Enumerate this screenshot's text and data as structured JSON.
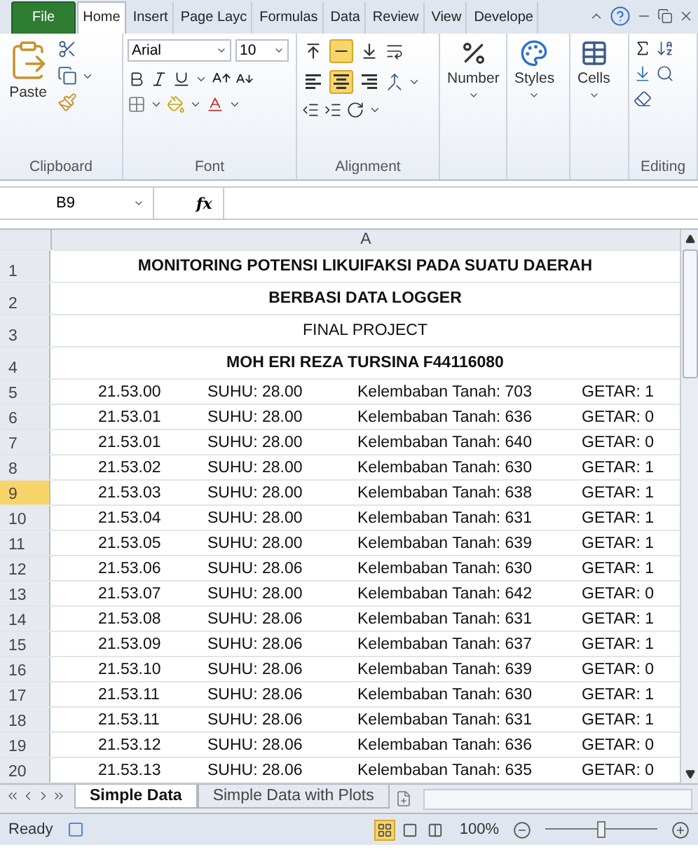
{
  "menu_tabs": [
    {
      "label": "File",
      "kind": "file",
      "selected": false
    },
    {
      "label": "Home",
      "kind": "tab",
      "selected": true
    },
    {
      "label": "Insert",
      "kind": "tab",
      "selected": false
    },
    {
      "label": "Page Layc",
      "kind": "tab",
      "selected": false
    },
    {
      "label": "Formulas",
      "kind": "tab",
      "selected": false
    },
    {
      "label": "Data",
      "kind": "tab",
      "selected": false
    },
    {
      "label": "Review",
      "kind": "tab",
      "selected": false
    },
    {
      "label": "View",
      "kind": "tab",
      "selected": false
    },
    {
      "label": "Develope",
      "kind": "tab",
      "selected": false
    }
  ],
  "ribbon": {
    "clipboard": {
      "label": "Clipboard",
      "paste": "Paste"
    },
    "font": {
      "label": "Font",
      "name": "Arial",
      "size": "10"
    },
    "alignment": {
      "label": "Alignment",
      "vertical": [
        {
          "kind": "top",
          "selected": false
        },
        {
          "kind": "middle",
          "selected": true
        },
        {
          "kind": "bottom",
          "selected": false
        }
      ],
      "horizontal": [
        {
          "kind": "left",
          "selected": false
        },
        {
          "kind": "center",
          "selected": true
        },
        {
          "kind": "right",
          "selected": false
        }
      ]
    },
    "number": {
      "label": "Number"
    },
    "styles": {
      "label": "Styles"
    },
    "cells": {
      "label": "Cells"
    },
    "editing": {
      "label": "Editing"
    }
  },
  "formula_bar": {
    "name_box": "B9",
    "function_symbol": "fx"
  },
  "sheet": {
    "column": "A",
    "rows": [
      {
        "number": "1",
        "kind": "title",
        "bold": true,
        "selected": false,
        "text": "MONITORING POTENSI LIKUIFAKSI PADA SUATU DAERAH"
      },
      {
        "number": "2",
        "kind": "title",
        "bold": true,
        "selected": false,
        "text": "BERBASI DATA LOGGER"
      },
      {
        "number": "3",
        "kind": "title",
        "bold": false,
        "selected": false,
        "text": "FINAL PROJECT"
      },
      {
        "number": "4",
        "kind": "title",
        "bold": true,
        "selected": false,
        "text": "MOH ERI REZA TURSINA F44116080"
      },
      {
        "number": "5",
        "kind": "data",
        "selected": false,
        "cells": [
          "21.53.00",
          "SUHU: 28.00",
          "Kelembaban Tanah: 703",
          "GETAR: 1"
        ]
      },
      {
        "number": "6",
        "kind": "data",
        "selected": false,
        "cells": [
          "21.53.01",
          "SUHU: 28.00",
          "Kelembaban Tanah: 636",
          "GETAR: 0"
        ]
      },
      {
        "number": "7",
        "kind": "data",
        "selected": false,
        "cells": [
          "21.53.01",
          "SUHU: 28.00",
          "Kelembaban Tanah: 640",
          "GETAR: 0"
        ]
      },
      {
        "number": "8",
        "kind": "data",
        "selected": false,
        "cells": [
          "21.53.02",
          "SUHU: 28.00",
          "Kelembaban Tanah: 630",
          "GETAR: 1"
        ]
      },
      {
        "number": "9",
        "kind": "data",
        "selected": true,
        "cells": [
          "21.53.03",
          "SUHU: 28.00",
          "Kelembaban Tanah: 638",
          "GETAR: 1"
        ]
      },
      {
        "number": "10",
        "kind": "data",
        "selected": false,
        "cells": [
          "21.53.04",
          "SUHU: 28.00",
          "Kelembaban Tanah: 631",
          "GETAR: 1"
        ]
      },
      {
        "number": "11",
        "kind": "data",
        "selected": false,
        "cells": [
          "21.53.05",
          "SUHU: 28.00",
          "Kelembaban Tanah: 639",
          "GETAR: 1"
        ]
      },
      {
        "number": "12",
        "kind": "data",
        "selected": false,
        "cells": [
          "21.53.06",
          "SUHU: 28.06",
          "Kelembaban Tanah: 630",
          "GETAR: 1"
        ]
      },
      {
        "number": "13",
        "kind": "data",
        "selected": false,
        "cells": [
          "21.53.07",
          "SUHU: 28.00",
          "Kelembaban Tanah: 642",
          "GETAR: 0"
        ]
      },
      {
        "number": "14",
        "kind": "data",
        "selected": false,
        "cells": [
          "21.53.08",
          "SUHU: 28.06",
          "Kelembaban Tanah: 631",
          "GETAR: 1"
        ]
      },
      {
        "number": "15",
        "kind": "data",
        "selected": false,
        "cells": [
          "21.53.09",
          "SUHU: 28.06",
          "Kelembaban Tanah: 637",
          "GETAR: 1"
        ]
      },
      {
        "number": "16",
        "kind": "data",
        "selected": false,
        "cells": [
          "21.53.10",
          "SUHU: 28.06",
          "Kelembaban Tanah: 639",
          "GETAR: 0"
        ]
      },
      {
        "number": "17",
        "kind": "data",
        "selected": false,
        "cells": [
          "21.53.11",
          "SUHU: 28.06",
          "Kelembaban Tanah: 630",
          "GETAR: 1"
        ]
      },
      {
        "number": "18",
        "kind": "data",
        "selected": false,
        "cells": [
          "21.53.11",
          "SUHU: 28.06",
          "Kelembaban Tanah: 631",
          "GETAR: 1"
        ]
      },
      {
        "number": "19",
        "kind": "data",
        "selected": false,
        "cells": [
          "21.53.12",
          "SUHU: 28.06",
          "Kelembaban Tanah: 636",
          "GETAR: 0"
        ]
      },
      {
        "number": "20",
        "kind": "data",
        "selected": false,
        "cells": [
          "21.53.13",
          "SUHU: 28.06",
          "Kelembaban Tanah: 635",
          "GETAR: 0"
        ]
      }
    ]
  },
  "sheet_tabs": [
    {
      "label": "Simple Data",
      "selected": true
    },
    {
      "label": "Simple Data with Plots",
      "selected": false
    }
  ],
  "status_bar": {
    "status": "Ready",
    "views": [
      {
        "kind": "normal",
        "selected": true
      },
      {
        "kind": "layout",
        "selected": false
      },
      {
        "kind": "break",
        "selected": false
      }
    ],
    "zoom": "100%",
    "zoom_slider": {
      "level": 0.5
    }
  }
}
